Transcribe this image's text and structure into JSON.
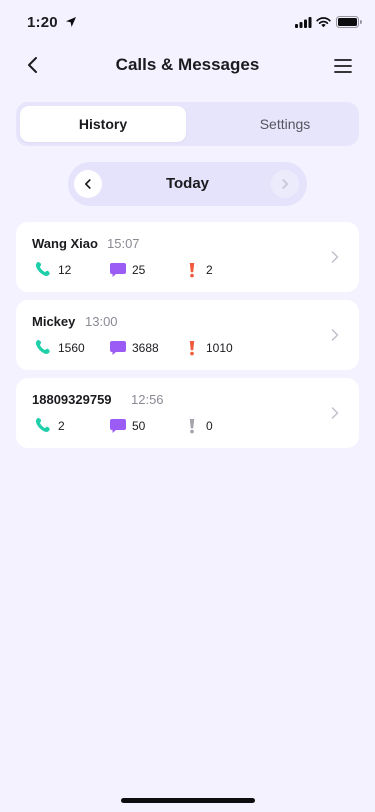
{
  "status_bar": {
    "time": "1:20"
  },
  "nav": {
    "title": "Calls & Messages"
  },
  "tabs": [
    {
      "label": "History",
      "active": true
    },
    {
      "label": "Settings",
      "active": false
    }
  ],
  "date_switcher": {
    "label": "Today"
  },
  "records": [
    {
      "name": "Wang Xiao",
      "time": "15:07",
      "calls": "12",
      "messages": "25",
      "alerts": "2",
      "alert_active": true
    },
    {
      "name": "Mickey",
      "time": "13:00",
      "calls": "1560",
      "messages": "3688",
      "alerts": "1010",
      "alert_active": true
    },
    {
      "name": "18809329759",
      "time": "12:56",
      "calls": "2",
      "messages": "50",
      "alerts": "0",
      "alert_active": false
    }
  ],
  "colors": {
    "background": "#f3f2fe",
    "call_icon": "#1fcfa9",
    "message_icon": "#9b5cf6",
    "alert_icon": "#f05a3c",
    "alert_icon_inactive": "#a3a3ab"
  },
  "icons": [
    "location-arrow-icon",
    "signal-icon",
    "wifi-icon",
    "battery-icon",
    "back-arrow-icon",
    "menu-icon",
    "chevron-left-icon",
    "chevron-right-icon",
    "phone-icon",
    "message-icon",
    "exclamation-icon"
  ]
}
